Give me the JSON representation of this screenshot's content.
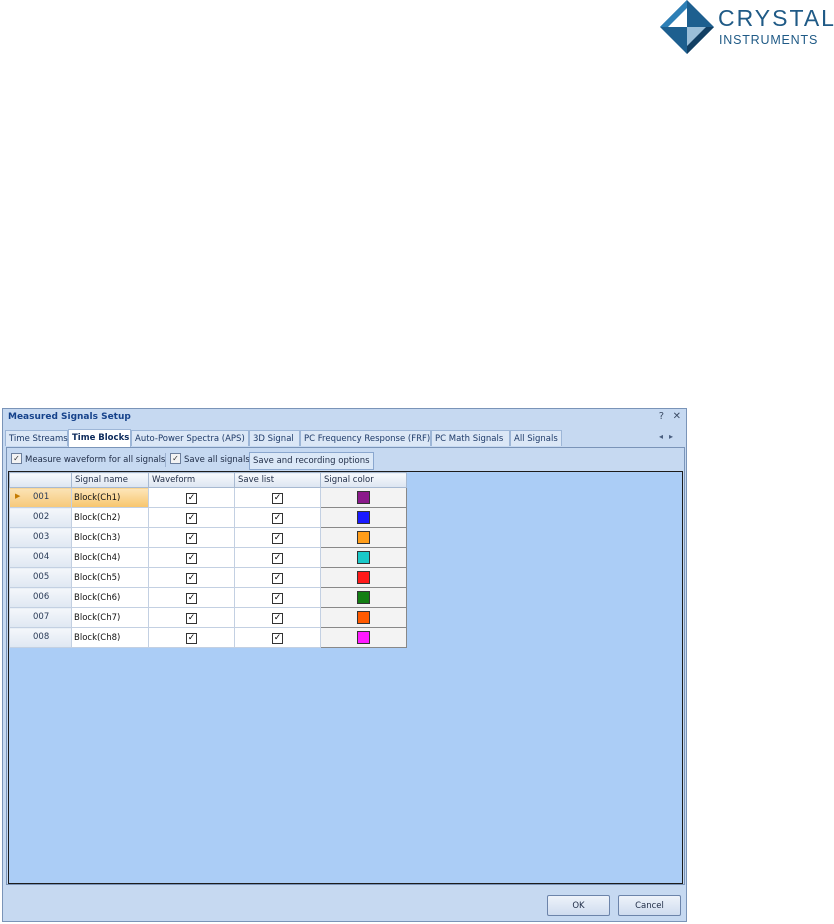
{
  "logo": {
    "line1": "CRYSTAL",
    "line2": "INSTRUMENTS"
  },
  "dialog": {
    "title": "Measured Signals Setup",
    "help_glyph": "?",
    "close_glyph": "✕",
    "tabs": [
      "Time Streams",
      "Time Blocks",
      "Auto-Power Spectra (APS)",
      "3D Signal",
      "PC Frequency Response (FRF)",
      "PC Math Signals",
      "All Signals"
    ],
    "active_tab": "Time Blocks",
    "tab_scroll_arrows": "◂▸",
    "toolbar": {
      "measure_waveform_label": "Measure waveform for all signals",
      "save_all_label": "Save all signals",
      "options_button": "Save and recording options"
    },
    "grid": {
      "columns": [
        "",
        "Signal name",
        "Waveform",
        "Save list",
        "Signal color"
      ],
      "rows": [
        {
          "num": "001",
          "name": "Block(Ch1)",
          "waveform": true,
          "save": true,
          "color": "#8b1a8b",
          "selected": true
        },
        {
          "num": "002",
          "name": "Block(Ch2)",
          "waveform": true,
          "save": true,
          "color": "#1a1aff"
        },
        {
          "num": "003",
          "name": "Block(Ch3)",
          "waveform": true,
          "save": true,
          "color": "#ff9d1a"
        },
        {
          "num": "004",
          "name": "Block(Ch4)",
          "waveform": true,
          "save": true,
          "color": "#1ac9c9"
        },
        {
          "num": "005",
          "name": "Block(Ch5)",
          "waveform": true,
          "save": true,
          "color": "#ff1a1a"
        },
        {
          "num": "006",
          "name": "Block(Ch6)",
          "waveform": true,
          "save": true,
          "color": "#137e13"
        },
        {
          "num": "007",
          "name": "Block(Ch7)",
          "waveform": true,
          "save": true,
          "color": "#ff5a00"
        },
        {
          "num": "008",
          "name": "Block(Ch8)",
          "waveform": true,
          "save": true,
          "color": "#ff1aff"
        }
      ]
    },
    "buttons": {
      "ok": "OK",
      "cancel": "Cancel"
    }
  }
}
